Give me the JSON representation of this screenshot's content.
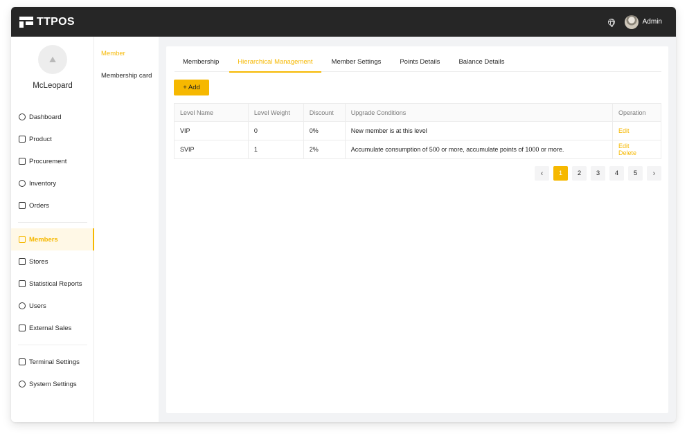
{
  "app": {
    "logo_text": "TTPOS",
    "user_name": "Admin"
  },
  "profile": {
    "name": "McLeopard"
  },
  "nav": {
    "items": [
      {
        "label": "Dashboard",
        "icon": "dashboard-icon"
      },
      {
        "label": "Product",
        "icon": "product-icon"
      },
      {
        "label": "Procurement",
        "icon": "cart-icon"
      },
      {
        "label": "Inventory",
        "icon": "inventory-icon"
      },
      {
        "label": "Orders",
        "icon": "orders-icon"
      },
      {
        "label": "Members",
        "icon": "members-icon",
        "active": true
      },
      {
        "label": "Stores",
        "icon": "stores-icon"
      },
      {
        "label": "Statistical Reports",
        "icon": "reports-icon"
      },
      {
        "label": "Users",
        "icon": "users-icon"
      },
      {
        "label": "External Sales",
        "icon": "external-sales-icon"
      },
      {
        "label": "Terminal Settings",
        "icon": "terminal-icon"
      },
      {
        "label": "System Settings",
        "icon": "settings-icon"
      }
    ]
  },
  "submenu": {
    "items": [
      "Member",
      "Membership card"
    ],
    "active_index": 0
  },
  "tabs": [
    "Membership",
    "Hierarchical Management",
    "Member Settings",
    "Points Details",
    "Balance Details"
  ],
  "active_tab": "Hierarchical Management",
  "toolbar": {
    "add_label": "+ Add"
  },
  "table": {
    "headers": [
      "Level Name",
      "Level Weight",
      "Discount",
      "Upgrade Conditions",
      "Operation"
    ],
    "rows": [
      {
        "level_name": "VIP",
        "level_weight": "0",
        "discount": "0%",
        "upgrade_conditions": "New member is at this level",
        "operations": [
          "Edit"
        ]
      },
      {
        "level_name": "SVIP",
        "level_weight": "1",
        "discount": "2%",
        "upgrade_conditions": "Accumulate consumption of 500 or more, accumulate points of 1000 or more.",
        "operations": [
          "Edit",
          "Delete"
        ]
      }
    ]
  },
  "pagination": {
    "prev": "‹",
    "next": "›",
    "pages": [
      "1",
      "2",
      "3",
      "4",
      "5"
    ],
    "current": "1"
  },
  "colors": {
    "accent": "#f6b800",
    "topbar": "#262626",
    "background": "#f2f3f5"
  }
}
